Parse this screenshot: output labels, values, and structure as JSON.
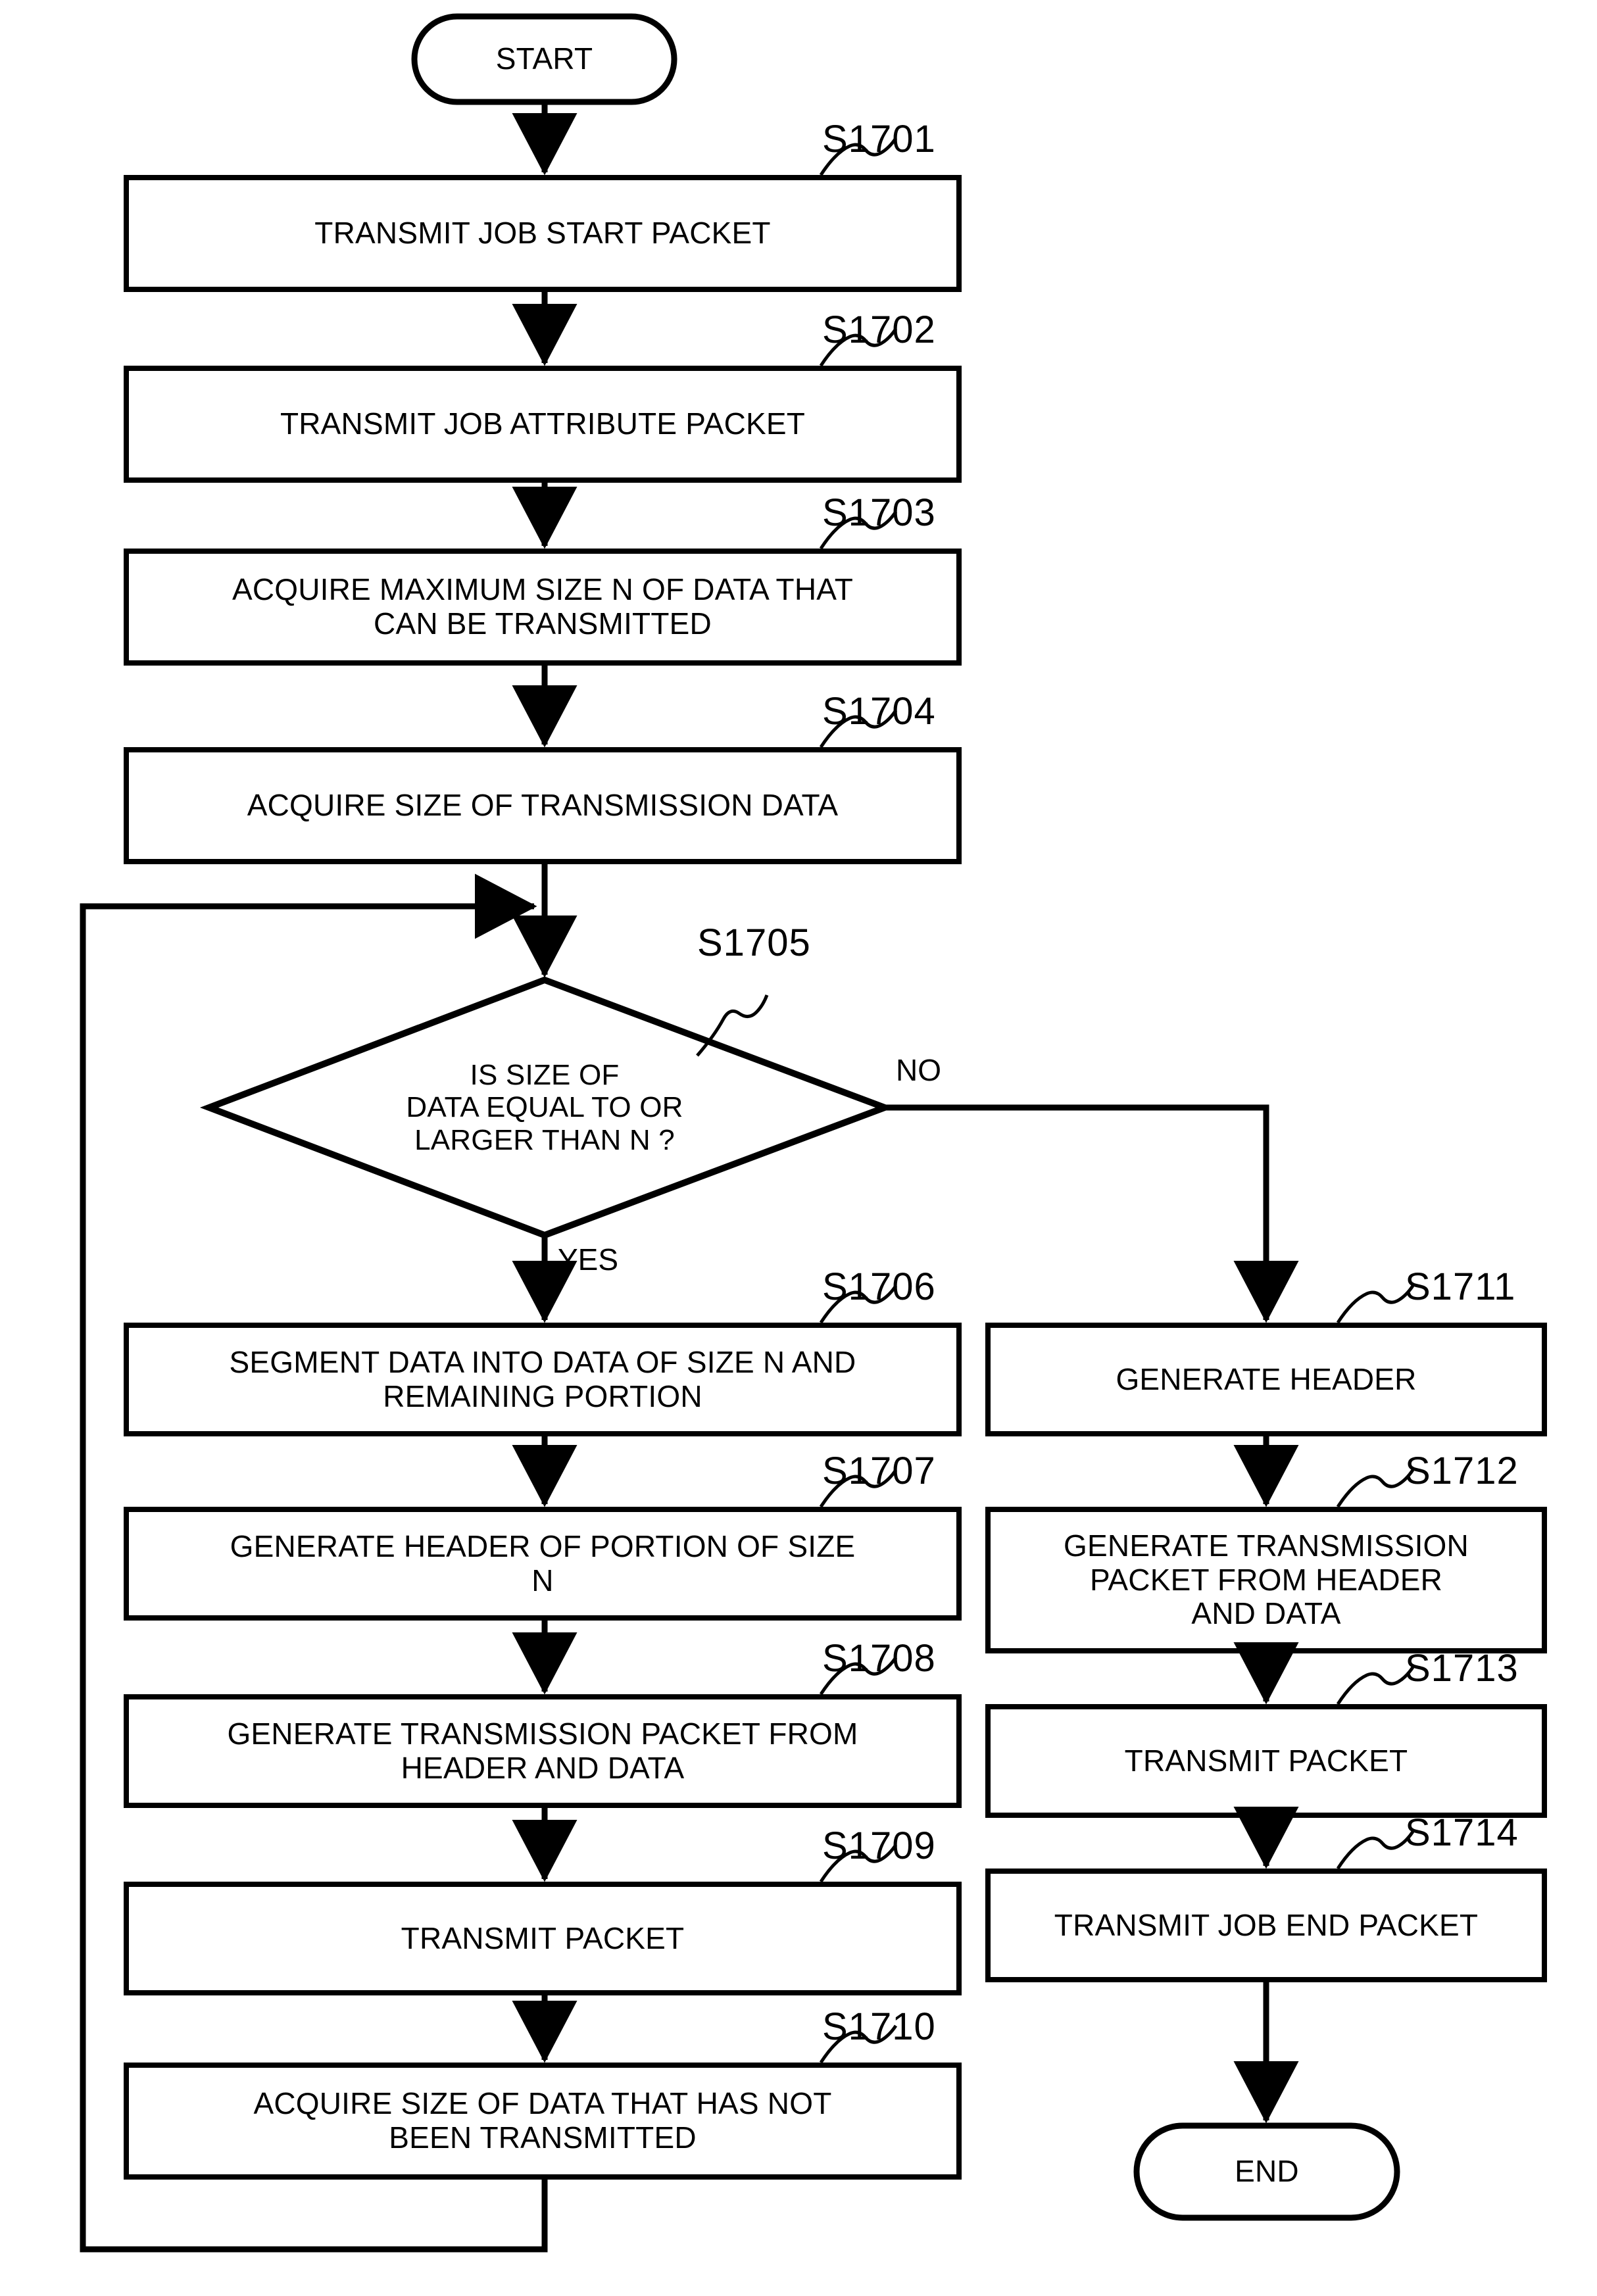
{
  "diagram": {
    "type": "flowchart",
    "title": "",
    "terminators": {
      "start": "START",
      "end": "END"
    },
    "branch_labels": {
      "yes": "YES",
      "no": "NO"
    },
    "steps": [
      {
        "id": "S1701",
        "label": "S1701",
        "text": "TRANSMIT JOB START PACKET"
      },
      {
        "id": "S1702",
        "label": "S1702",
        "text": "TRANSMIT JOB ATTRIBUTE PACKET"
      },
      {
        "id": "S1703",
        "label": "S1703",
        "text": "ACQUIRE MAXIMUM SIZE N OF DATA THAT\nCAN BE TRANSMITTED"
      },
      {
        "id": "S1704",
        "label": "S1704",
        "text": "ACQUIRE SIZE OF TRANSMISSION DATA"
      },
      {
        "id": "S1705",
        "label": "S1705",
        "text": "IS SIZE OF\nDATA EQUAL TO OR\nLARGER THAN N ?"
      },
      {
        "id": "S1706",
        "label": "S1706",
        "text": "SEGMENT DATA INTO DATA OF SIZE N AND\nREMAINING PORTION"
      },
      {
        "id": "S1707",
        "label": "S1707",
        "text": "GENERATE HEADER OF PORTION OF SIZE\nN"
      },
      {
        "id": "S1708",
        "label": "S1708",
        "text": "GENERATE TRANSMISSION PACKET FROM\nHEADER AND DATA"
      },
      {
        "id": "S1709",
        "label": "S1709",
        "text": "TRANSMIT PACKET"
      },
      {
        "id": "S1710",
        "label": "S1710",
        "text": "ACQUIRE SIZE OF DATA THAT HAS NOT\nBEEN TRANSMITTED"
      },
      {
        "id": "S1711",
        "label": "S1711",
        "text": "GENERATE HEADER"
      },
      {
        "id": "S1712",
        "label": "S1712",
        "text": "GENERATE TRANSMISSION\nPACKET FROM HEADER\nAND DATA"
      },
      {
        "id": "S1713",
        "label": "S1713",
        "text": "TRANSMIT PACKET"
      },
      {
        "id": "S1714",
        "label": "S1714",
        "text": "TRANSMIT JOB END PACKET"
      }
    ],
    "colors": {
      "stroke": "#000000",
      "fill": "#ffffff",
      "text": "#000000"
    }
  }
}
